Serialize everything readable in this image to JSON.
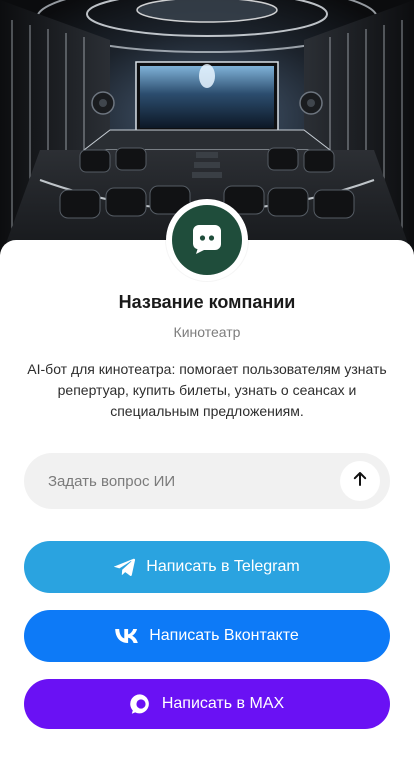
{
  "colors": {
    "avatar_bg": "#1f4d3b",
    "telegram": "#2aa3e0",
    "vk": "#0d7af7",
    "max": "#6a11f4",
    "input_bg": "#f1f1f1"
  },
  "cover": {
    "icon": "home-theater-image"
  },
  "profile": {
    "avatar_icon": "chat-bot-icon",
    "company_name": "Название компании",
    "company_type": "Кинотеатр",
    "description": "AI-бот для кинотеатра: помогает пользователям узнать репертуар, купить билеты, узнать о сеансах и специальным предложениям."
  },
  "ask": {
    "placeholder": "Задать вопрос ИИ",
    "value": "",
    "send_icon": "arrow-up-icon"
  },
  "buttons": {
    "telegram": {
      "label": "Написать в Telegram",
      "icon": "telegram-icon"
    },
    "vk": {
      "label": "Написать Вконтакте",
      "icon": "vk-icon"
    },
    "max": {
      "label": "Написать в MAX",
      "icon": "max-icon"
    }
  }
}
